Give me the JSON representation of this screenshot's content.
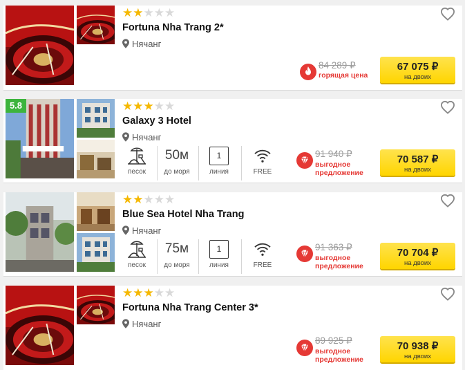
{
  "hotels": [
    {
      "stars": "★★",
      "stars_off": "★★★",
      "name": "Fortuna Nha Trang 2*",
      "location": "Нячанг",
      "old_price": "84 289 ₽",
      "deal_label": "горящая цена",
      "deal_type": "fire-icon",
      "price": "67 075 ₽",
      "price_sub": "на двоих"
    },
    {
      "rating": "5.8",
      "stars": "★★★",
      "stars_off": "★★",
      "name": "Galaxy 3 Hotel",
      "location": "Нячанг",
      "beach_label": "песок",
      "distance_value": "50м",
      "distance_label": "до моря",
      "line_value": "1",
      "line_label": "линия",
      "wifi_label": "FREE",
      "old_price": "91 940 ₽",
      "deal_label_1": "выгодное",
      "deal_label_2": "предложение",
      "deal_type": "diamond-icon",
      "price": "70 587 ₽",
      "price_sub": "на двоих"
    },
    {
      "stars": "★★",
      "stars_off": "★★★",
      "name": "Blue Sea Hotel Nha Trang",
      "location": "Нячанг",
      "beach_label": "песок",
      "distance_value": "75м",
      "distance_label": "до моря",
      "line_value": "1",
      "line_label": "линия",
      "wifi_label": "FREE",
      "old_price": "91 363 ₽",
      "deal_label_1": "выгодное",
      "deal_label_2": "предложение",
      "deal_type": "diamond-icon",
      "price": "70 704 ₽",
      "price_sub": "на двоих"
    },
    {
      "stars": "★★★",
      "stars_off": "★★",
      "name": "Fortuna Nha Trang Center 3*",
      "location": "Нячанг",
      "old_price": "89 925 ₽",
      "deal_label_1": "выгодное",
      "deal_label_2": "предложение",
      "deal_type": "diamond-icon",
      "price": "70 938 ₽",
      "price_sub": "на двоих"
    }
  ],
  "colors": {
    "price_button": "#ffd500",
    "deal_red": "#e53935",
    "star_on": "#f5b800",
    "rating_badge": "#3db43d"
  }
}
